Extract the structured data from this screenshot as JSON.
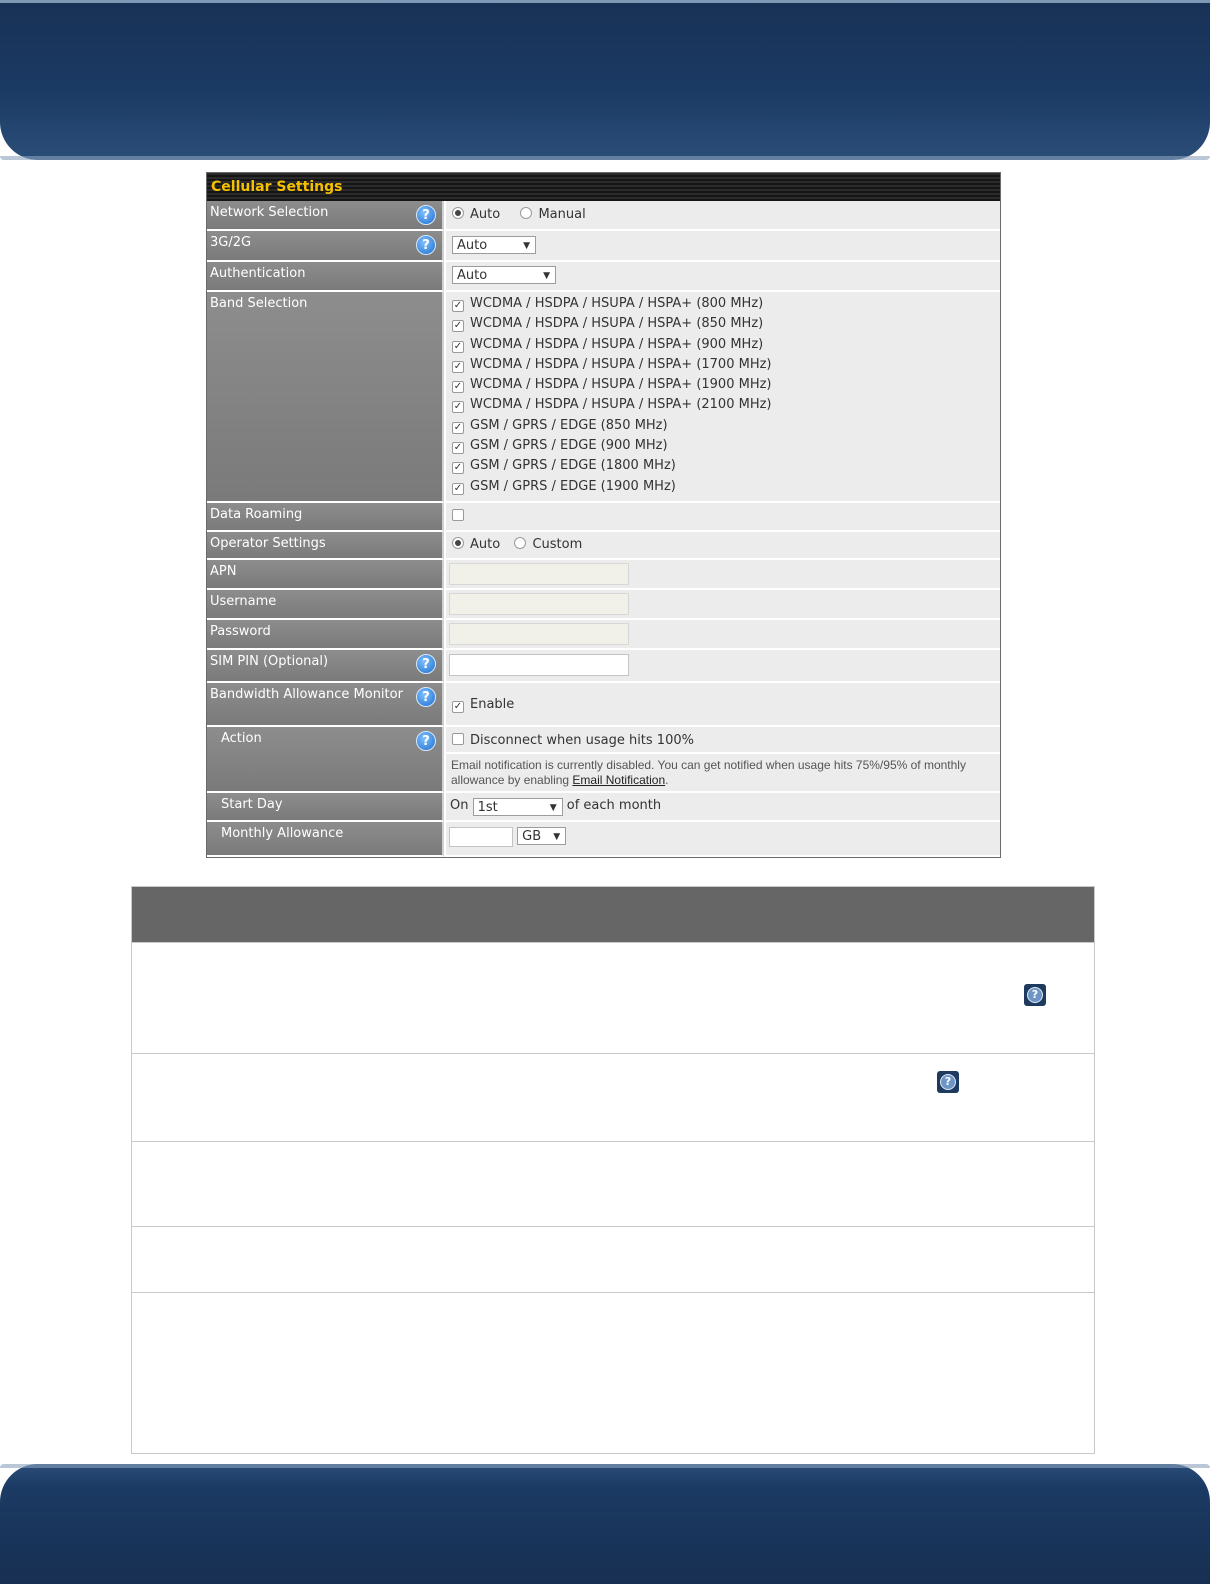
{
  "panel": {
    "title": "Cellular Settings",
    "network_selection": {
      "label": "Network Selection",
      "options": [
        "Auto",
        "Manual"
      ],
      "selected": "Auto"
    },
    "g32": {
      "label": "3G/2G",
      "value": "Auto"
    },
    "authentication": {
      "label": "Authentication",
      "value": "Auto"
    },
    "band_selection": {
      "label": "Band Selection",
      "bands": [
        "WCDMA / HSDPA / HSUPA / HSPA+ (800 MHz)",
        "WCDMA / HSDPA / HSUPA / HSPA+ (850 MHz)",
        "WCDMA / HSDPA / HSUPA / HSPA+ (900 MHz)",
        "WCDMA / HSDPA / HSUPA / HSPA+ (1700 MHz)",
        "WCDMA / HSDPA / HSUPA / HSPA+ (1900 MHz)",
        "WCDMA / HSDPA / HSUPA / HSPA+ (2100 MHz)",
        "GSM / GPRS / EDGE (850 MHz)",
        "GSM / GPRS / EDGE (900 MHz)",
        "GSM / GPRS / EDGE (1800 MHz)",
        "GSM / GPRS / EDGE (1900 MHz)"
      ]
    },
    "data_roaming": {
      "label": "Data Roaming"
    },
    "operator_settings": {
      "label": "Operator Settings",
      "options": [
        "Auto",
        "Custom"
      ],
      "selected": "Auto"
    },
    "apn": {
      "label": "APN"
    },
    "username": {
      "label": "Username"
    },
    "password": {
      "label": "Password"
    },
    "sim_pin": {
      "label": "SIM PIN (Optional)"
    },
    "bandwidth_monitor": {
      "label": "Bandwidth Allowance Monitor",
      "enable_label": "Enable"
    },
    "action": {
      "label": "Action",
      "disconnect_label": "Disconnect when usage hits 100%",
      "note_text": "Email notification is currently disabled. You can get notified when usage hits 75%/95% of monthly allowance by enabling ",
      "note_link": "Email Notification",
      "note_end": "."
    },
    "start_day": {
      "label": "Start Day",
      "prefix": "On",
      "value": "1st",
      "suffix": "of each month"
    },
    "monthly_allowance": {
      "label": "Monthly Allowance",
      "unit": "GB"
    }
  },
  "icons": {
    "help": "help-icon",
    "radio": "radio-button",
    "checkbox": "checkbox"
  },
  "colors": {
    "title_text": "#f5c000",
    "header_band": "#1b3a63",
    "label_bg": "#858585",
    "value_bg": "#ececec",
    "help_blue": "#1d6fcf"
  }
}
